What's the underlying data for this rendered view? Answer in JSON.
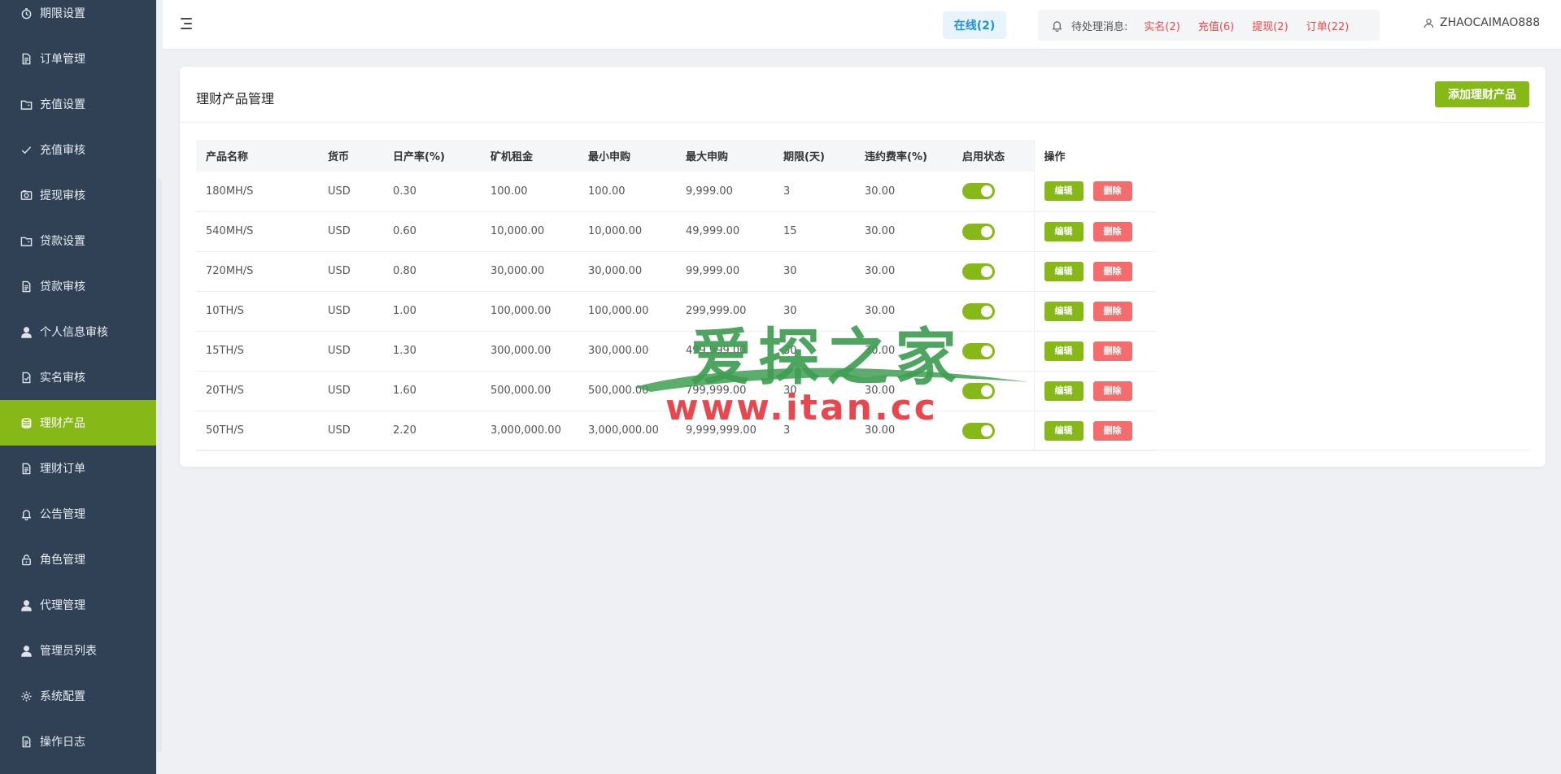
{
  "sidebar": {
    "items": [
      {
        "label": "期限设置",
        "icon": "clock-icon"
      },
      {
        "label": "订单管理",
        "icon": "document-icon"
      },
      {
        "label": "充值设置",
        "icon": "folder-icon"
      },
      {
        "label": "充值审核",
        "icon": "check-icon"
      },
      {
        "label": "提现审核",
        "icon": "photo-icon"
      },
      {
        "label": "贷款设置",
        "icon": "folder-icon"
      },
      {
        "label": "贷款审核",
        "icon": "document-icon"
      },
      {
        "label": "个人信息审核",
        "icon": "user-icon"
      },
      {
        "label": "实名审核",
        "icon": "check-document-icon"
      },
      {
        "label": "理财产品",
        "icon": "coins-icon"
      },
      {
        "label": "理财订单",
        "icon": "document-icon"
      },
      {
        "label": "公告管理",
        "icon": "bell-icon"
      },
      {
        "label": "角色管理",
        "icon": "lock-icon"
      },
      {
        "label": "代理管理",
        "icon": "user-icon"
      },
      {
        "label": "管理员列表",
        "icon": "user-icon"
      },
      {
        "label": "系统配置",
        "icon": "gear-icon"
      },
      {
        "label": "操作日志",
        "icon": "document-icon"
      }
    ],
    "active_index": 9
  },
  "header": {
    "online": "在线(2)",
    "notice_label": "待处理消息:",
    "notices": [
      "实名(2)",
      "充值(6)",
      "提现(2)",
      "订单(22)"
    ],
    "username": "ZHAOCAIMAO888"
  },
  "card": {
    "title": "理财产品管理",
    "add_button": "添加理财产品"
  },
  "table": {
    "columns": [
      "产品名称",
      "货币",
      "日产率(%)",
      "矿机租金",
      "最小申购",
      "最大申购",
      "期限(天)",
      "违约费率(%)",
      "启用状态",
      "操作"
    ],
    "rows": [
      [
        "180MH/S",
        "USD",
        "0.30",
        "100.00",
        "100.00",
        "9,999.00",
        "3",
        "30.00"
      ],
      [
        "540MH/S",
        "USD",
        "0.60",
        "10,000.00",
        "10,000.00",
        "49,999.00",
        "15",
        "30.00"
      ],
      [
        "720MH/S",
        "USD",
        "0.80",
        "30,000.00",
        "30,000.00",
        "99,999.00",
        "30",
        "30.00"
      ],
      [
        "10TH/S",
        "USD",
        "1.00",
        "100,000.00",
        "100,000.00",
        "299,999.00",
        "30",
        "30.00"
      ],
      [
        "15TH/S",
        "USD",
        "1.30",
        "300,000.00",
        "300,000.00",
        "499,999.00",
        "30",
        "30.00"
      ],
      [
        "20TH/S",
        "USD",
        "1.60",
        "500,000.00",
        "500,000.00",
        "799,999.00",
        "30",
        "30.00"
      ],
      [
        "50TH/S",
        "USD",
        "2.20",
        "3,000,000.00",
        "3,000,000.00",
        "9,999,999.00",
        "3",
        "30.00"
      ]
    ],
    "enabled": [
      true,
      true,
      true,
      true,
      true,
      true,
      true
    ],
    "edit_label": "编辑",
    "delete_label": "删除"
  },
  "watermark": {
    "cn": "爱探之家",
    "en": "www.itan.cc"
  },
  "colors": {
    "sidebar_bg": "#304156",
    "accent": "#86b817",
    "danger": "#f56c6c",
    "notice": "#f04848",
    "online": "#1f8fe0"
  }
}
